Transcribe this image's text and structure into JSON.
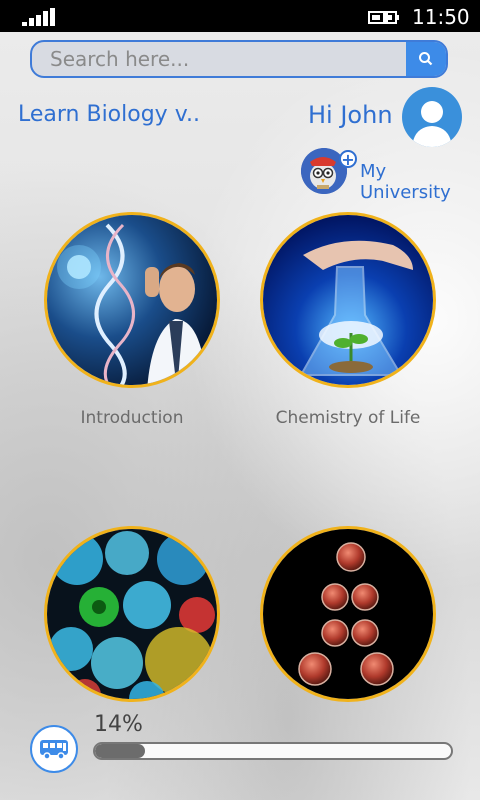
{
  "status_bar": {
    "time": "11:50"
  },
  "search": {
    "placeholder": "Search here..."
  },
  "header": {
    "app_title": "Learn Biology v..",
    "greeting": "Hi John"
  },
  "university": {
    "label": "My University"
  },
  "topics": [
    {
      "label": "Introduction"
    },
    {
      "label": "Chemistry of Life"
    },
    {
      "label": ""
    },
    {
      "label": ""
    }
  ],
  "progress": {
    "text": "14%",
    "value": 0.14
  },
  "colors": {
    "accent": "#2f6fd1",
    "ring": "#f0b21b",
    "search_button": "#3d8be8"
  },
  "icons": {
    "search": "search-icon",
    "avatar": "user-avatar-icon",
    "bus": "bus-icon",
    "add": "plus-icon"
  }
}
